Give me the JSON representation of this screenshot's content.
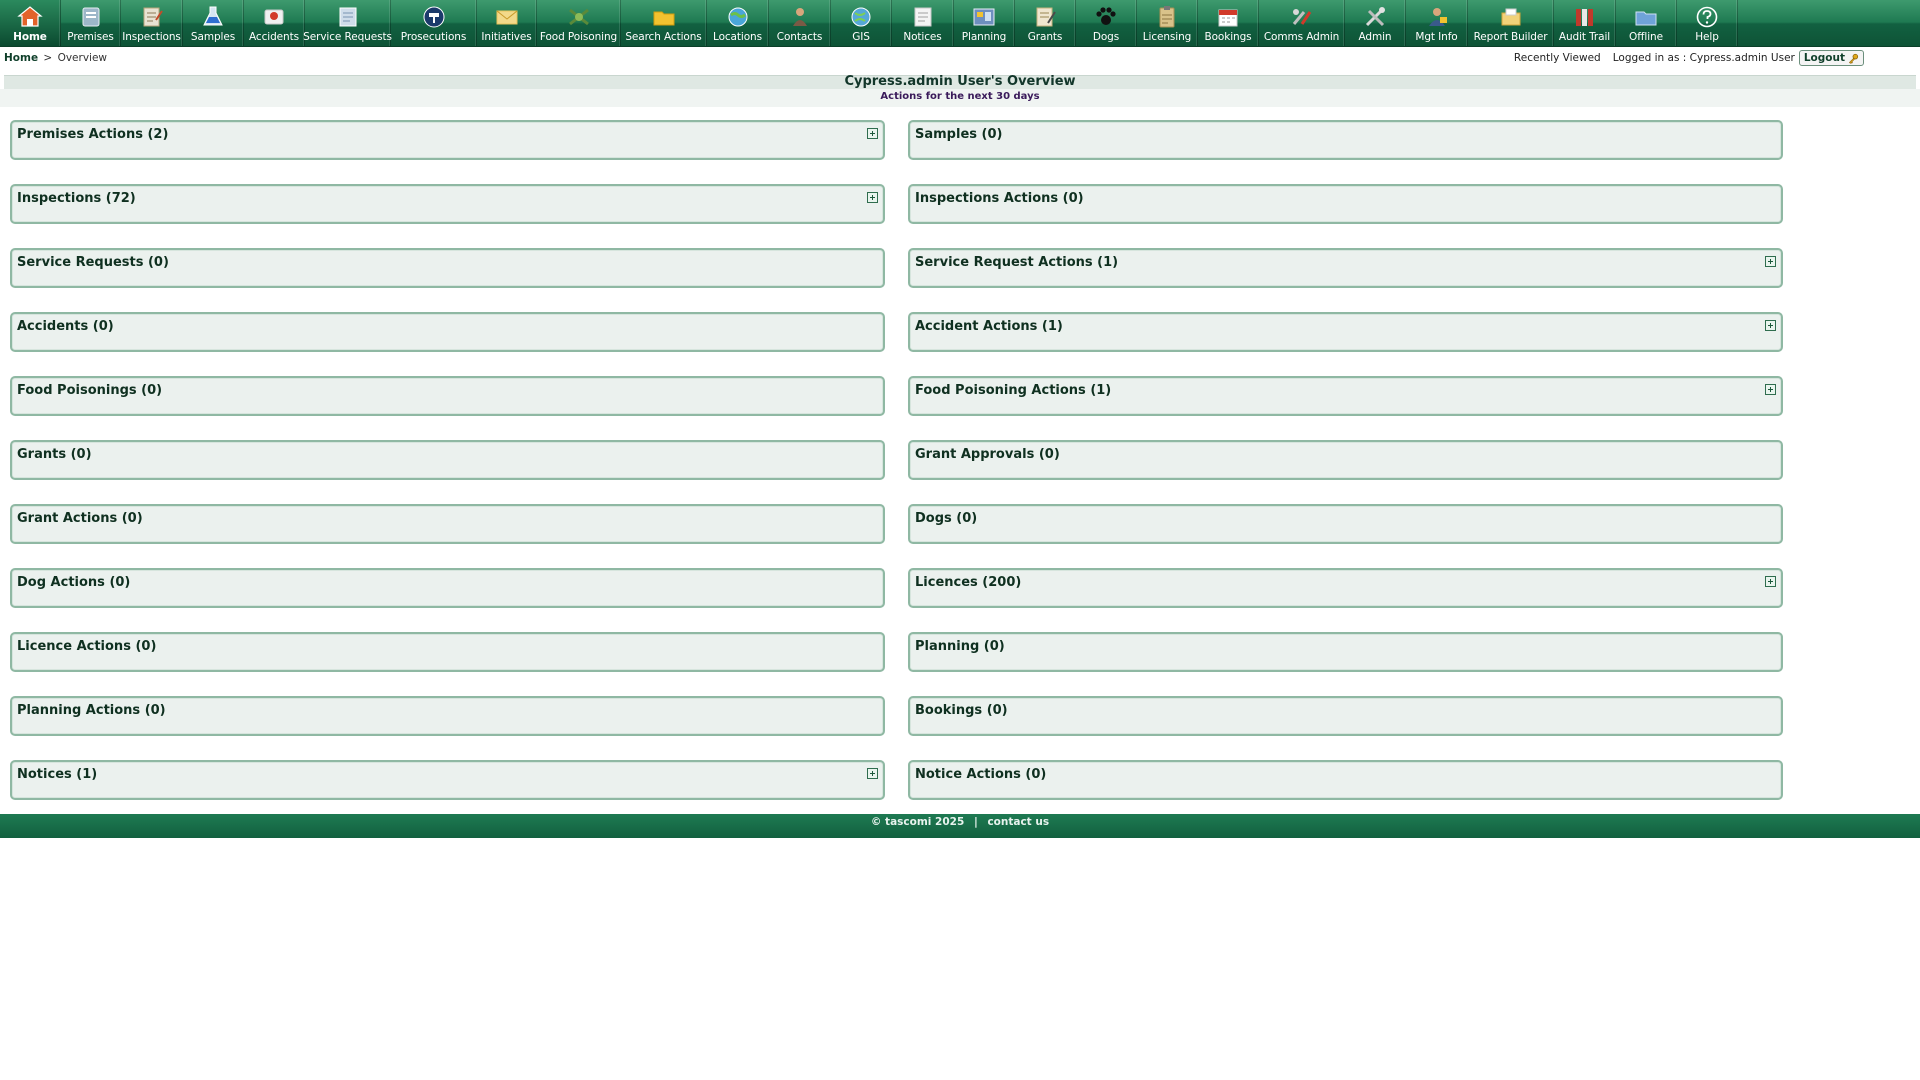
{
  "nav": [
    {
      "label": "Home",
      "icon": "home-icon",
      "active": true
    },
    {
      "label": "Premises",
      "icon": "premises-icon"
    },
    {
      "label": "Inspections",
      "icon": "inspections-icon"
    },
    {
      "label": "Samples",
      "icon": "samples-flask-icon"
    },
    {
      "label": "Accidents",
      "icon": "accidents-icon"
    },
    {
      "label": "Service Requests",
      "icon": "service-requests-icon"
    },
    {
      "label": "Prosecutions",
      "icon": "prosecutions-gavel-icon"
    },
    {
      "label": "Initiatives",
      "icon": "initiatives-envelope-icon"
    },
    {
      "label": "Food Poisoning",
      "icon": "food-poisoning-icon"
    },
    {
      "label": "Search Actions",
      "icon": "search-actions-folder-icon"
    },
    {
      "label": "Locations",
      "icon": "locations-globe-icon"
    },
    {
      "label": "Contacts",
      "icon": "contacts-person-icon"
    },
    {
      "label": "GIS",
      "icon": "gis-globe-icon"
    },
    {
      "label": "Notices",
      "icon": "notices-icon"
    },
    {
      "label": "Planning",
      "icon": "planning-icon"
    },
    {
      "label": "Grants",
      "icon": "grants-icon"
    },
    {
      "label": "Dogs",
      "icon": "dogs-paw-icon"
    },
    {
      "label": "Licensing",
      "icon": "licensing-clipboard-icon"
    },
    {
      "label": "Bookings",
      "icon": "bookings-calendar-icon"
    },
    {
      "label": "Comms Admin",
      "icon": "comms-admin-icon"
    },
    {
      "label": "Admin",
      "icon": "admin-tools-icon"
    },
    {
      "label": "Mgt Info",
      "icon": "mgt-info-icon"
    },
    {
      "label": "Report Builder",
      "icon": "report-builder-icon"
    },
    {
      "label": "Audit Trail",
      "icon": "audit-trail-icon"
    },
    {
      "label": "Offline",
      "icon": "offline-folder-icon"
    },
    {
      "label": "Help",
      "icon": "help-question-icon"
    }
  ],
  "breadcrumb": {
    "home": "Home",
    "separator": ">",
    "current": "Overview"
  },
  "user": {
    "recently_viewed": "Recently Viewed",
    "logged_in_as": "Logged in as : Cypress.admin User",
    "logout_label": "Logout"
  },
  "page": {
    "title": "Cypress.admin User's Overview",
    "subtitle": "Actions for the next 30 days"
  },
  "panels": [
    {
      "title": "Premises Actions (2)",
      "expandable": true
    },
    {
      "title": "Samples (0)",
      "expandable": false
    },
    {
      "title": "Inspections (72)",
      "expandable": true
    },
    {
      "title": "Inspections Actions (0)",
      "expandable": false
    },
    {
      "title": "Service Requests (0)",
      "expandable": false
    },
    {
      "title": "Service Request Actions (1)",
      "expandable": true
    },
    {
      "title": "Accidents (0)",
      "expandable": false
    },
    {
      "title": "Accident Actions (1)",
      "expandable": true
    },
    {
      "title": "Food Poisonings (0)",
      "expandable": false
    },
    {
      "title": "Food Poisoning Actions (1)",
      "expandable": true
    },
    {
      "title": "Grants (0)",
      "expandable": false
    },
    {
      "title": "Grant Approvals (0)",
      "expandable": false
    },
    {
      "title": "Grant Actions (0)",
      "expandable": false
    },
    {
      "title": "Dogs (0)",
      "expandable": false
    },
    {
      "title": "Dog Actions (0)",
      "expandable": false
    },
    {
      "title": "Licences (200)",
      "expandable": true
    },
    {
      "title": "Licence Actions (0)",
      "expandable": false
    },
    {
      "title": "Planning (0)",
      "expandable": false
    },
    {
      "title": "Planning Actions (0)",
      "expandable": false
    },
    {
      "title": "Bookings (0)",
      "expandable": false
    },
    {
      "title": "Notices (1)",
      "expandable": true
    },
    {
      "title": "Notice Actions (0)",
      "expandable": false
    }
  ],
  "footer": {
    "copyright": "© tascomi 2025",
    "separator": "|",
    "contact": "contact us"
  },
  "colors": {
    "nav_green": "#1f7a52",
    "panel_border": "#8fb8a3",
    "panel_bg": "#ebf1ee"
  }
}
